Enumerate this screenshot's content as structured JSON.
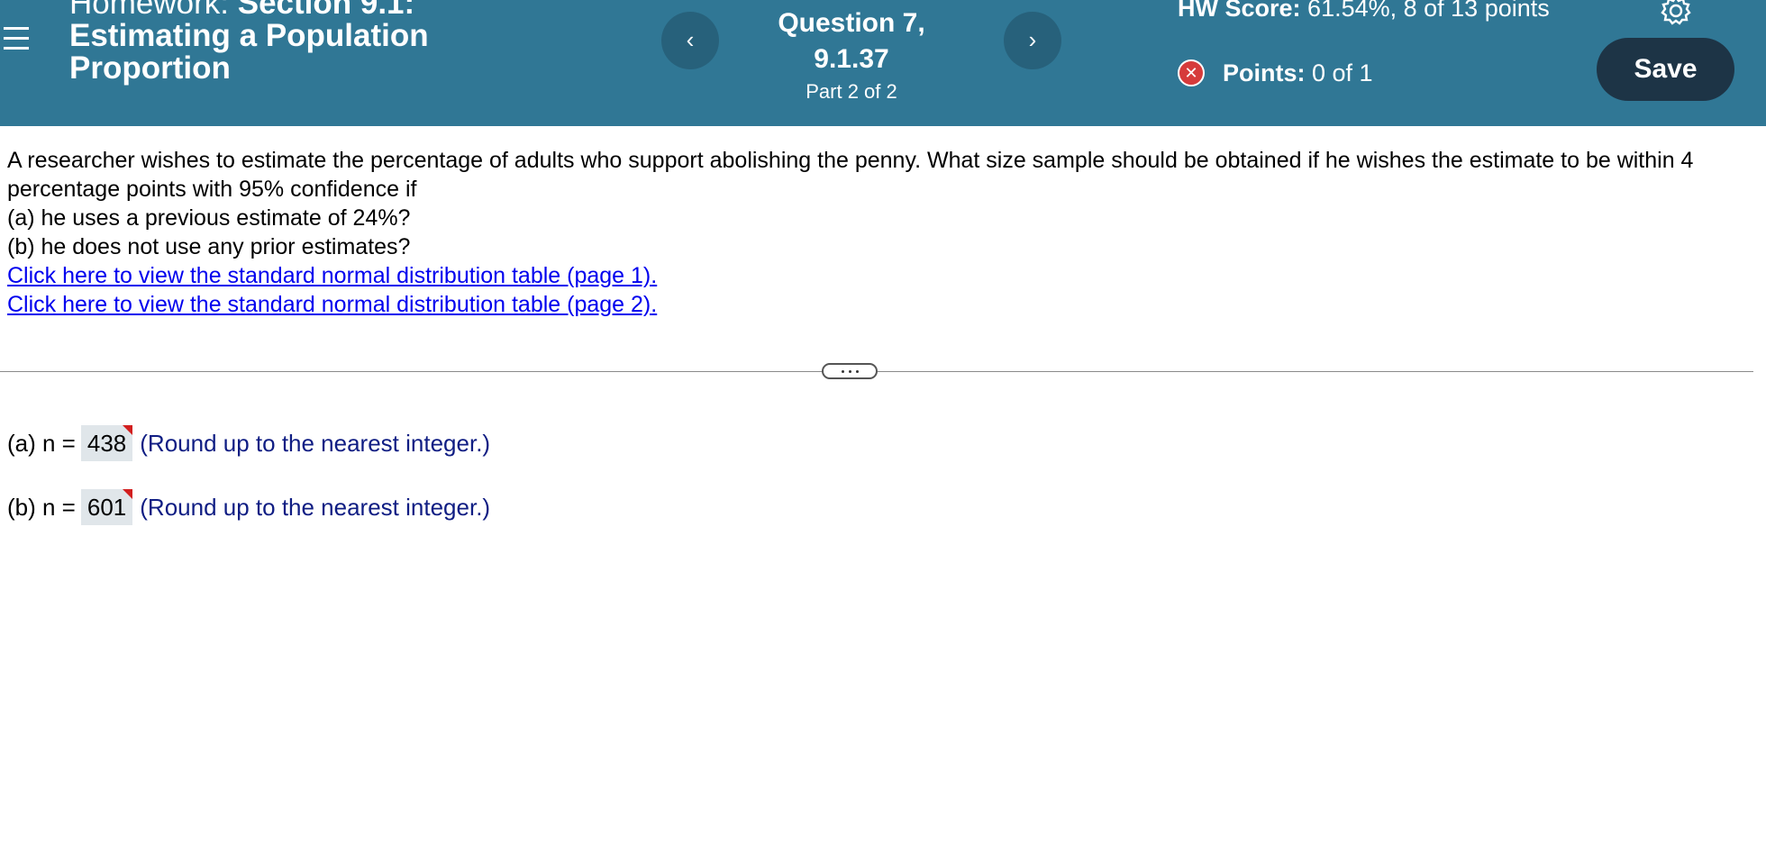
{
  "header": {
    "hw_prefix": "Homework:",
    "hw_title": "Section 9.1: Estimating a Population Proportion",
    "question_title": "Question 7, 9.1.37",
    "question_part": "Part 2 of 2",
    "hw_score_label": "HW Score:",
    "hw_score_value": "61.54%, 8 of 13 points",
    "points_label": "Points:",
    "points_value": "0 of 1",
    "save_label": "Save",
    "prev_icon": "‹",
    "next_icon": "›",
    "wrong_icon": "✕"
  },
  "question": {
    "paragraph": "A researcher wishes to estimate the percentage of adults who support abolishing the penny. What size sample should be obtained if he wishes the estimate to be within 4 percentage points with 95% confidence if",
    "part_a": "(a) he uses a previous estimate of 24%?",
    "part_b": "(b) he does not use any prior estimates?",
    "link_1": "Click here to view the standard normal distribution table (page 1).",
    "link_2": "Click here to view the standard normal distribution table (page 2)."
  },
  "answers": [
    {
      "label": "(a) n =",
      "value": "438",
      "hint": "(Round up to the nearest integer.)"
    },
    {
      "label": "(b) n =",
      "value": "601",
      "hint": "(Round up to the nearest integer.)"
    }
  ],
  "colors": {
    "header_bg": "#307795",
    "save_bg": "#1d3446",
    "link": "#0000ee",
    "hint": "#0f1d83",
    "error": "#d63b3b"
  }
}
